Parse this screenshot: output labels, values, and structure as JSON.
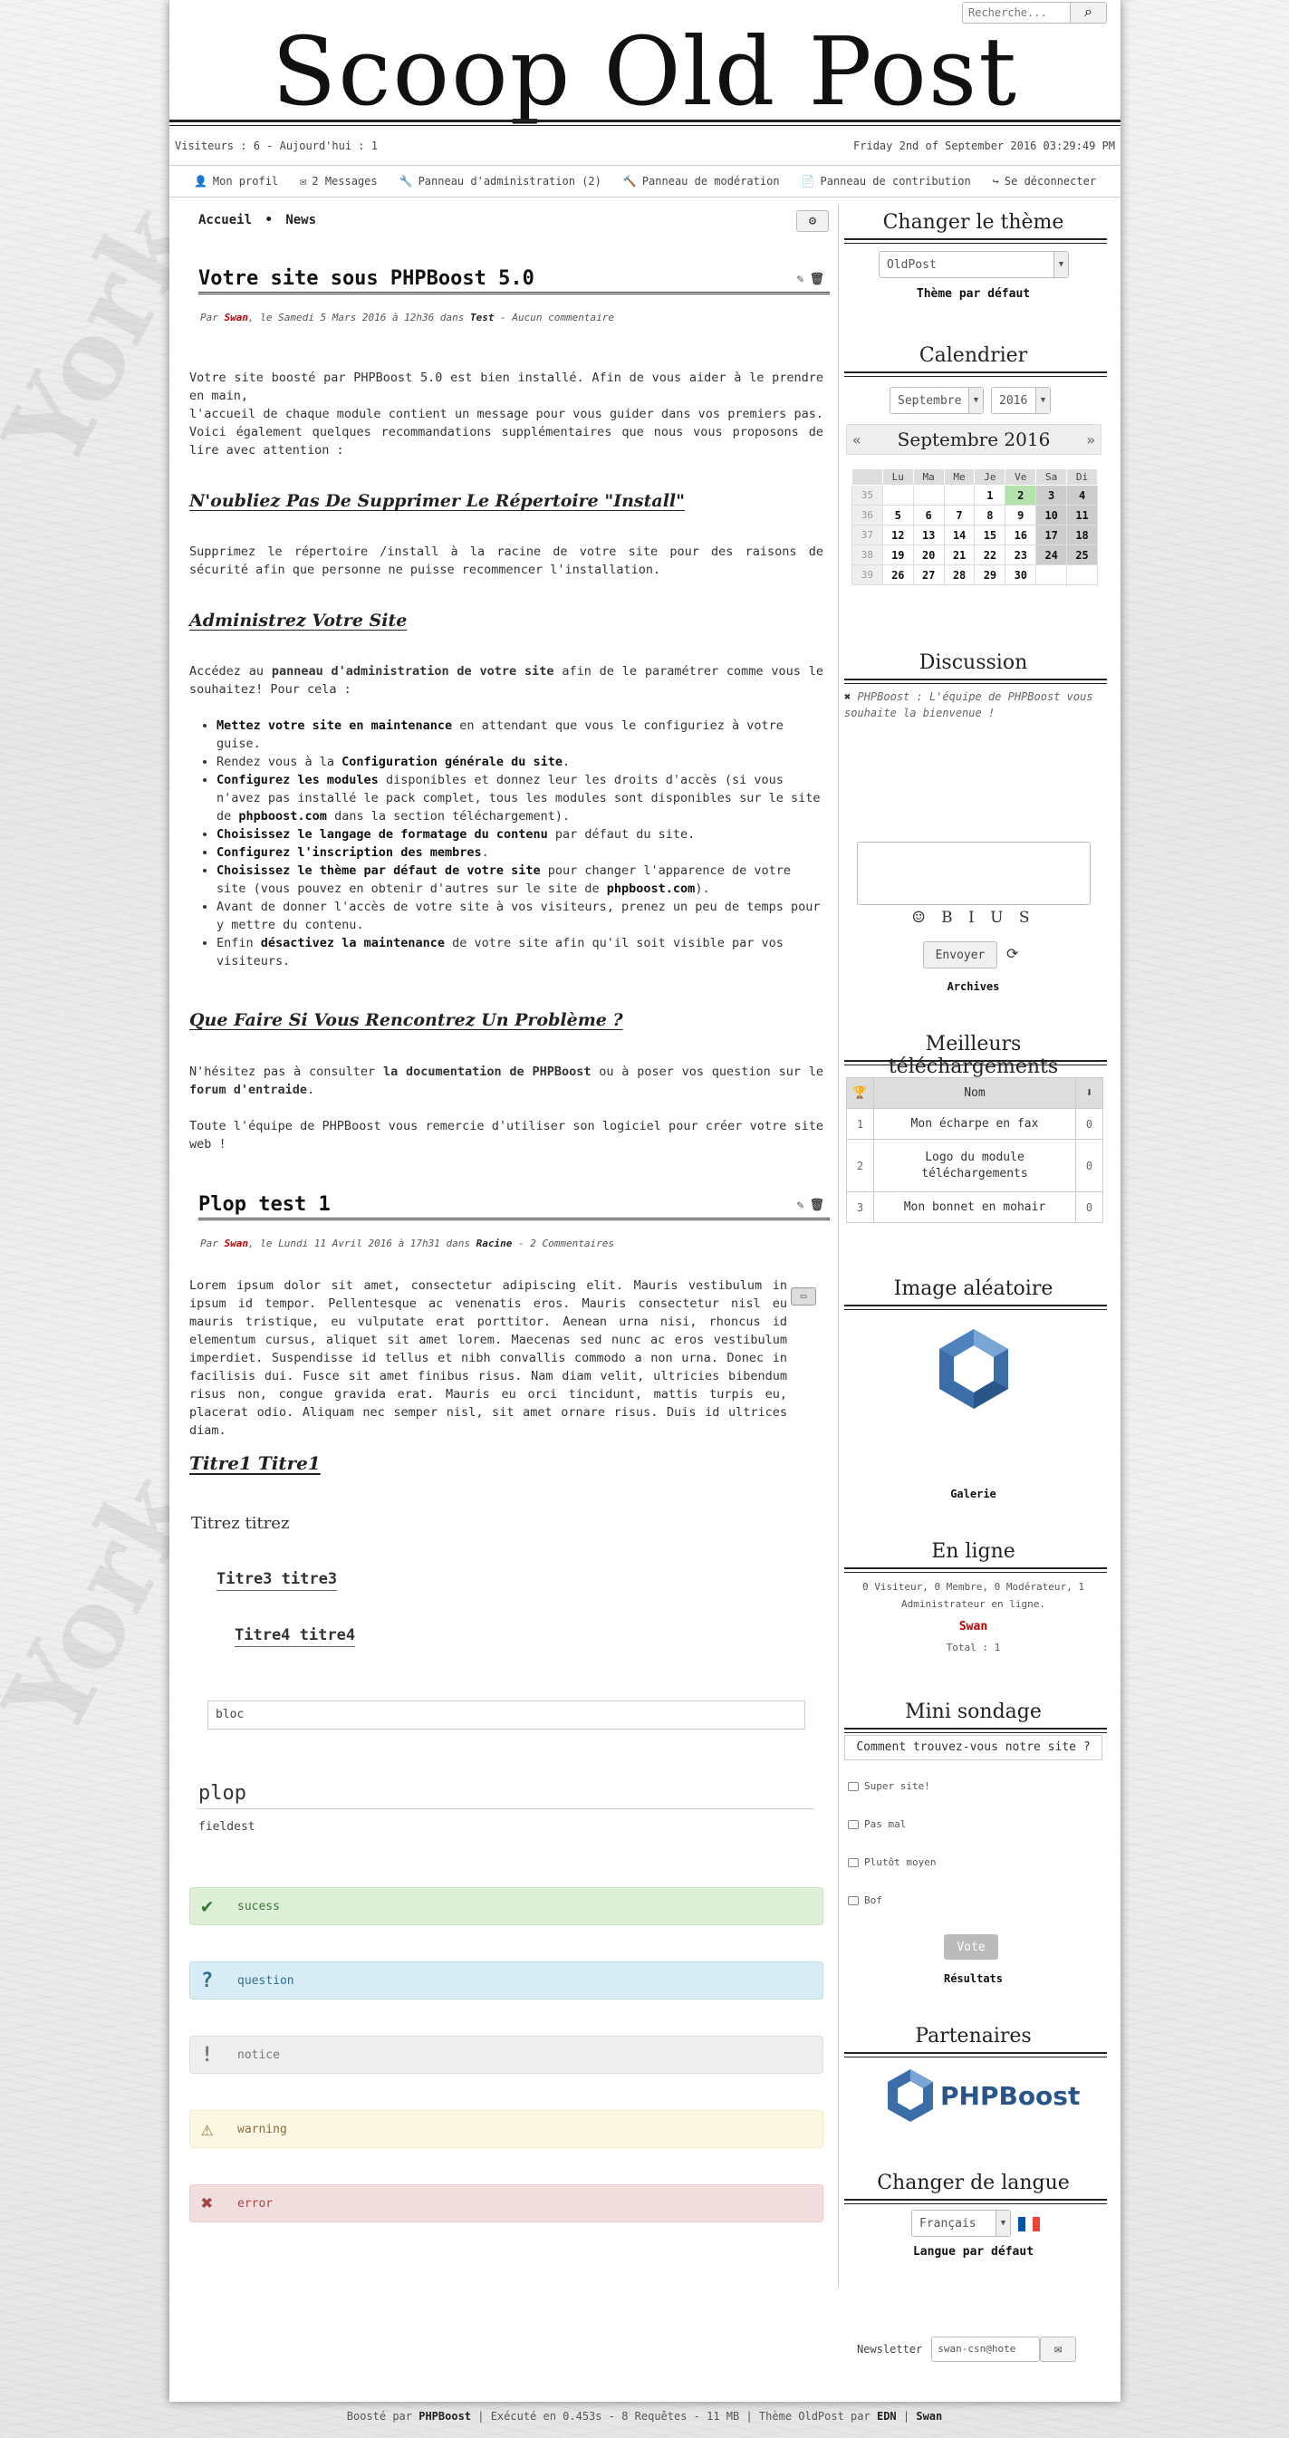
{
  "header": {
    "search_placeholder": "Recherche...",
    "site_title": "Scoop Old Post",
    "visitors": "Visiteurs : 6 - Aujourd'hui : 1",
    "datetime": "Friday 2nd of September 2016 03:29:49 PM"
  },
  "menu": [
    {
      "icon": "user-icon",
      "glyph": "👤",
      "label": "Mon profil"
    },
    {
      "icon": "envelope-icon",
      "glyph": "✉",
      "label": "2 Messages"
    },
    {
      "icon": "wrench-icon",
      "glyph": "🔧",
      "label": "Panneau d'administration (2)"
    },
    {
      "icon": "gavel-icon",
      "glyph": "🔨",
      "label": "Panneau de modération"
    },
    {
      "icon": "file-icon",
      "glyph": "📄",
      "label": "Panneau de contribution"
    },
    {
      "icon": "sign-out-icon",
      "glyph": "↪",
      "label": "Se déconnecter"
    }
  ],
  "breadcrumb": {
    "home": "Accueil",
    "sep": "•",
    "current": "News"
  },
  "article1": {
    "title": "Votre site sous PHPBoost 5.0",
    "meta_prefix": "Par ",
    "author": "Swan",
    "meta_date": ", le Samedi 5 Mars 2016 à 12h36 dans ",
    "category": "Test",
    "meta_suffix": " - Aucun commentaire",
    "intro_1": "Votre site boosté par PHPBoost 5.0 est bien installé. Afin de vous aider à le prendre en main,",
    "intro_2": "l'accueil de chaque module contient un message pour vous guider dans vos premiers pas. Voici également quelques recommandations supplémentaires que nous vous proposons de lire avec attention :",
    "h_install": "N'oubliez Pas De Supprimer Le Répertoire \"Install\"",
    "p_install": "Supprimez le répertoire /install à la racine de votre site pour des raisons de sécurité afin que personne ne puisse recommencer l'installation.",
    "h_admin": "Administrez Votre Site",
    "p_admin_1": "Accédez au ",
    "p_admin_b": "panneau d'administration de votre site",
    "p_admin_2": " afin de le paramétrer comme vous le souhaitez! Pour cela :",
    "list": [
      {
        "b": "Mettez votre site en maintenance",
        "t": " en attendant que vous le configuriez à votre guise."
      },
      {
        "pre": "Rendez vous à la ",
        "b": "Configuration générale du site",
        "t": "."
      },
      {
        "b": "Configurez les modules",
        "t": " disponibles et donnez leur les droits d'accès (si vous n'avez pas installé le pack complet, tous les modules sont disponibles sur le site de ",
        "b2": "phpboost.com",
        "t2": " dans la section téléchargement)."
      },
      {
        "b": "Choisissez le langage de formatage du contenu",
        "t": " par défaut du site."
      },
      {
        "b": "Configurez l'inscription des membres",
        "t": "."
      },
      {
        "b": "Choisissez le thème par défaut de votre site",
        "t": " pour changer l'apparence de votre site (vous pouvez en obtenir d'autres sur le site de ",
        "b2": "phpboost.com",
        "t2": ")."
      },
      {
        "t": "Avant de donner l'accès de votre site à vos visiteurs, prenez un peu de temps pour y mettre du contenu."
      },
      {
        "pre": "Enfin ",
        "b": "désactivez la maintenance",
        "t": " de votre site afin qu'il soit visible par vos visiteurs."
      }
    ],
    "h_problem": "Que Faire Si Vous Rencontrez Un Problème ?",
    "p_problem_1": "N'hésitez pas à consulter ",
    "p_problem_b1": "la documentation de PHPBoost",
    "p_problem_2": " ou à poser vos question sur le ",
    "p_problem_b2": "forum d'entraide",
    "p_problem_3": ".",
    "p_thanks": "Toute l'équipe de PHPBoost vous remercie d'utiliser son logiciel pour créer votre site web !"
  },
  "article2": {
    "title": "Plop test 1",
    "meta_prefix": "Par ",
    "author": "Swan",
    "meta_date": ", le Lundi 11 Avril 2016 à 17h31 dans ",
    "category": "Racine",
    "meta_suffix": " - 2 Commentaires",
    "lorem": "Lorem ipsum dolor sit amet, consectetur adipiscing elit. Mauris vestibulum in ipsum id tempor. Pellentesque ac venenatis eros. Mauris consectetur nisl eu mauris tristique, eu vulputate erat porttitor. Aenean urna nisi, rhoncus id elementum cursus, aliquet sit amet lorem. Maecenas sed nunc ac eros vestibulum imperdiet. Suspendisse id tellus et nibh convallis commodo a non urna. Donec in facilisis dui. Fusce sit amet finibus risus. Nam diam velit, ultricies bibendum risus non, congue gravida erat. Mauris eu orci tincidunt, mattis turpis eu, placerat odio. Aliquam nec semper nisl, sit amet ornare risus. Duis id ultrices diam.",
    "titre1": "Titre1 Titre1",
    "titre2": "Titrez titrez",
    "titre3": "Titre3 titre3",
    "titre4": "Titre4 titre4",
    "bloc": "bloc",
    "legend": "plop",
    "fieldset_text": "fieldest",
    "msg_success": "sucess",
    "msg_question": "question",
    "msg_notice": "notice",
    "msg_warning": "warning",
    "msg_error": "error"
  },
  "sidebar": {
    "theme_title": "Changer le thème",
    "theme_value": "OldPost",
    "theme_default": "Thème par défaut",
    "cal_title": "Calendrier",
    "cal_month_select": "Septembre",
    "cal_year_select": "2016",
    "cal_header": "Septembre 2016",
    "cal_days": [
      "Lu",
      "Ma",
      "Me",
      "Je",
      "Ve",
      "Sa",
      "Di"
    ],
    "cal_weeks": [
      {
        "wk": "35",
        "days": [
          "",
          "",
          "",
          "1",
          "2",
          "3",
          "4"
        ]
      },
      {
        "wk": "36",
        "days": [
          "5",
          "6",
          "7",
          "8",
          "9",
          "10",
          "11"
        ]
      },
      {
        "wk": "37",
        "days": [
          "12",
          "13",
          "14",
          "15",
          "16",
          "17",
          "18"
        ]
      },
      {
        "wk": "38",
        "days": [
          "19",
          "20",
          "21",
          "22",
          "23",
          "24",
          "25"
        ]
      },
      {
        "wk": "39",
        "days": [
          "26",
          "27",
          "28",
          "29",
          "30",
          "",
          ""
        ]
      }
    ],
    "cal_today": "2",
    "disc_title": "Discussion",
    "disc_user": "PHPBoost",
    "disc_msg": " : L'équipe de PHPBoost vous souhaite la bienvenue !",
    "fmt_buttons": "☺ B I U S",
    "send_label": "Envoyer",
    "archives": "Archives",
    "dl_title": "Meilleurs téléchargements",
    "dl_col": "Nom",
    "dl_rows": [
      {
        "n": "1",
        "name": "Mon écharpe en fax",
        "c": "0"
      },
      {
        "n": "2",
        "name": "Logo du module téléchargements",
        "c": "0"
      },
      {
        "n": "3",
        "name": "Mon bonnet en mohair",
        "c": "0"
      }
    ],
    "img_title": "Image aléatoire",
    "gallery": "Galerie",
    "online_title": "En ligne",
    "online_text": "0 Visiteur, 0 Membre, 0 Modérateur, 1 Administrateur en ligne.",
    "online_user": "Swan",
    "online_total": "Total : 1",
    "poll_title": "Mini sondage",
    "poll_q": "Comment trouvez-vous notre site ?",
    "poll_opts": [
      "Super site!",
      "Pas mal",
      "Plutôt moyen",
      "Bof"
    ],
    "vote": "Vote",
    "results": "Résultats",
    "partners_title": "Partenaires",
    "partner_name": "PHPBoost",
    "lang_title": "Changer de langue",
    "lang_value": "Français",
    "lang_default": "Langue par défaut"
  },
  "newsletter": {
    "label": "Newsletter",
    "value": "swan-csn@hote"
  },
  "footer": {
    "boost": "Boosté par ",
    "phpboost": "PHPBoost",
    "rest": " | Exécuté en 0.453s - 8 Requêtes - 11 MB | Thème OldPost par ",
    "edn": "EDN",
    "sep": " | ",
    "swan": "Swan"
  }
}
